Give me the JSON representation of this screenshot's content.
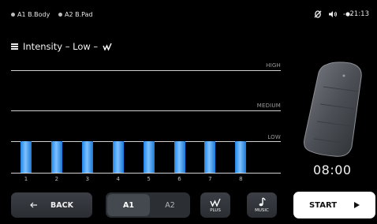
{
  "status": {
    "item1": "A1 B.Body",
    "item2": "A2 B.Pad",
    "time": "21:13"
  },
  "header": {
    "title": "Intensity – Low –"
  },
  "chart_data": {
    "type": "bar",
    "categories": [
      "1",
      "2",
      "3",
      "4",
      "5",
      "6",
      "7",
      "8"
    ],
    "values": [
      1,
      1,
      1,
      1,
      1,
      1,
      1,
      1
    ],
    "level_labels": [
      "HIGH",
      "MEDIUM",
      "LOW"
    ]
  },
  "timer": "08:00",
  "bottom": {
    "back_label": "BACK",
    "a1_label": "A1",
    "a2_label": "A2",
    "plus_label": "PLUS",
    "music_label": "MUSIC",
    "start_label": "START"
  },
  "colors": {
    "bar": "#3a9bf0",
    "start_bg": "#ffffff"
  }
}
